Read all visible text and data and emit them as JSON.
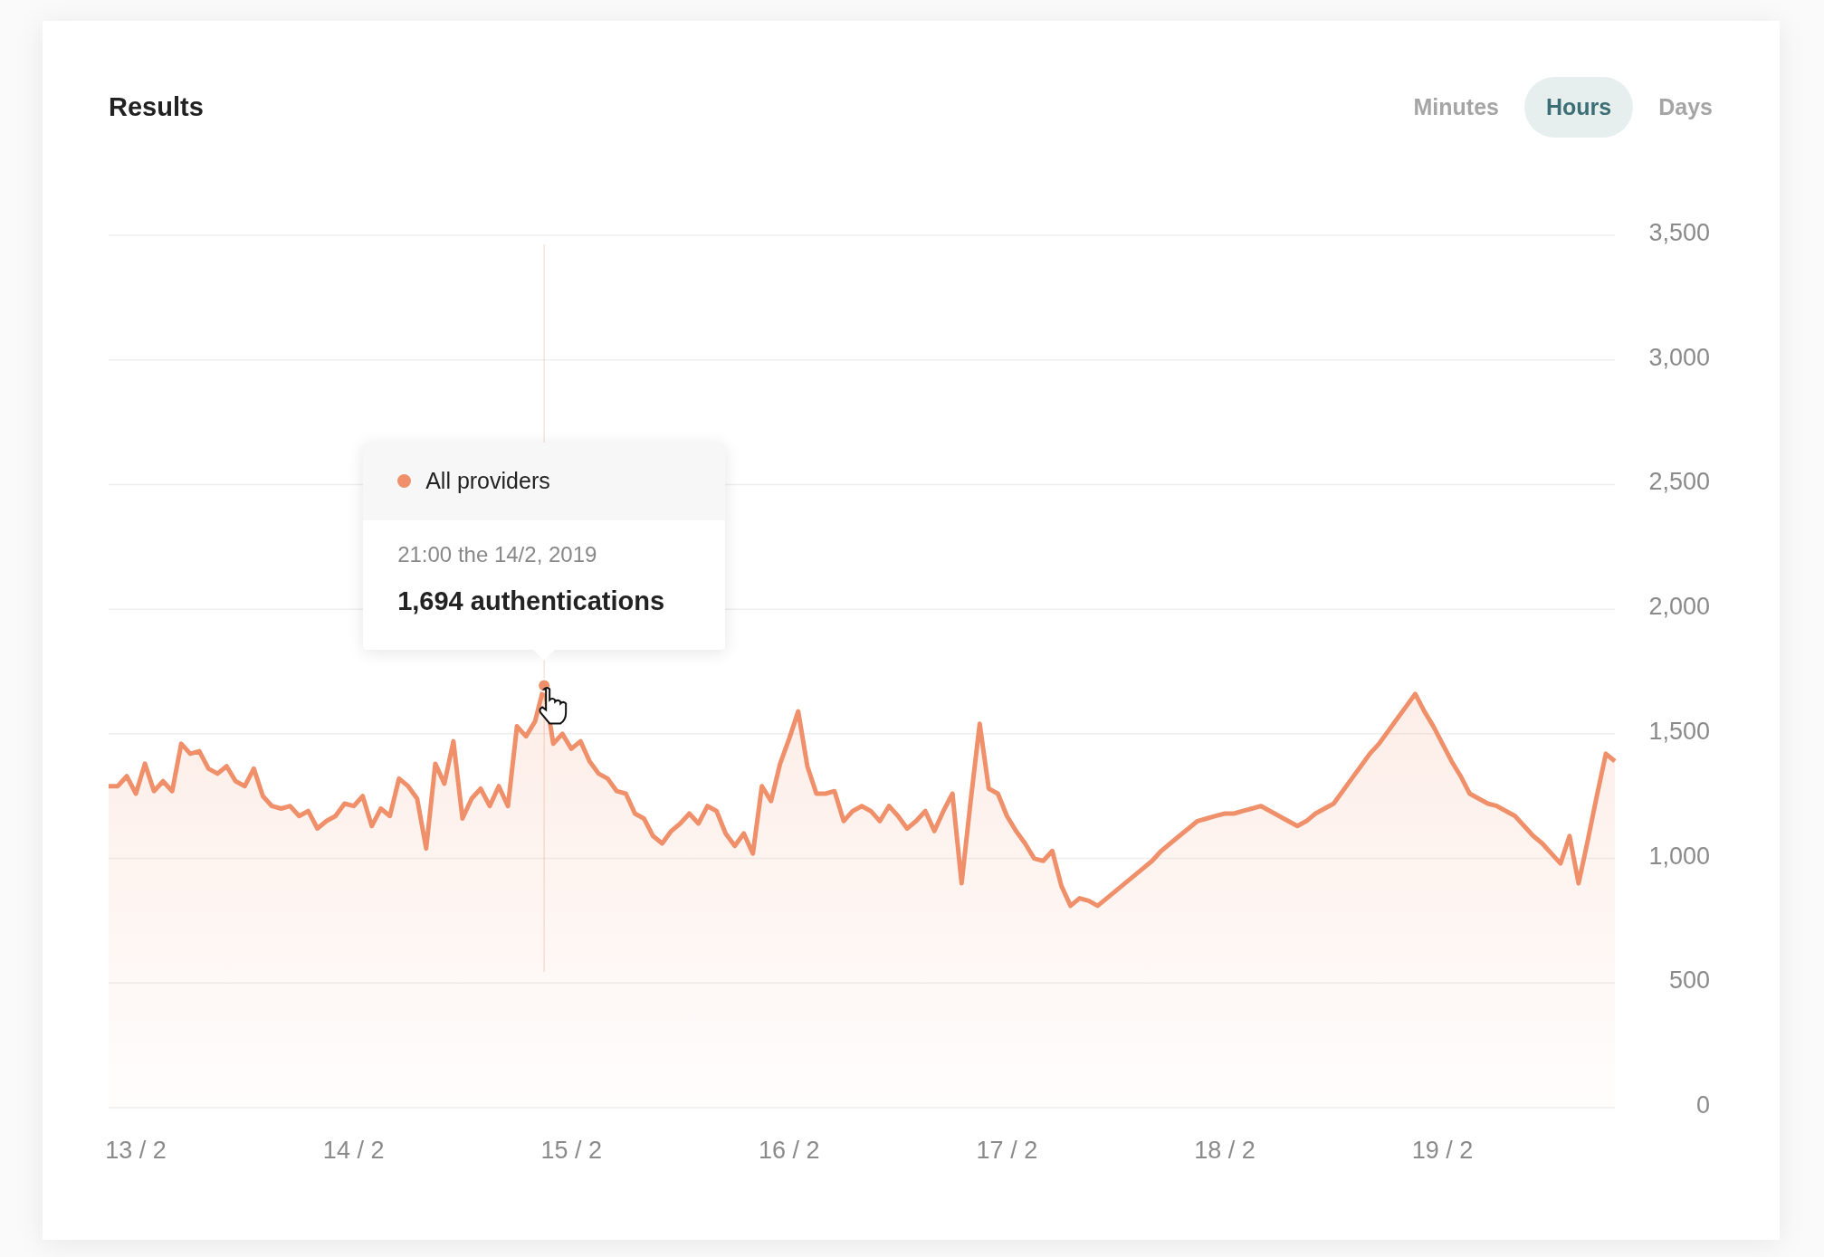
{
  "card": {
    "title": "Results"
  },
  "range_tabs": [
    {
      "label": "Minutes",
      "selected": false
    },
    {
      "label": "Hours",
      "selected": true
    },
    {
      "label": "Days",
      "selected": false
    }
  ],
  "chart": {
    "chart_data": {
      "type": "area",
      "categories": [
        null,
        null,
        null,
        "13 / 2",
        null,
        null,
        null,
        null,
        null,
        null,
        null,
        null,
        null,
        null,
        null,
        null,
        null,
        null,
        null,
        null,
        null,
        null,
        null,
        null,
        null,
        null,
        null,
        "14 / 2",
        null,
        null,
        null,
        null,
        null,
        null,
        null,
        null,
        null,
        null,
        null,
        null,
        null,
        null,
        null,
        null,
        null,
        null,
        null,
        null,
        null,
        null,
        null,
        "15 / 2",
        null,
        null,
        null,
        null,
        null,
        null,
        null,
        null,
        null,
        null,
        null,
        null,
        null,
        null,
        null,
        null,
        null,
        null,
        null,
        null,
        null,
        null,
        null,
        "16 / 2",
        null,
        null,
        null,
        null,
        null,
        null,
        null,
        null,
        null,
        null,
        null,
        null,
        null,
        null,
        null,
        null,
        null,
        null,
        null,
        null,
        null,
        null,
        null,
        "17 / 2",
        null,
        null,
        null,
        null,
        null,
        null,
        null,
        null,
        null,
        null,
        null,
        null,
        null,
        null,
        null,
        null,
        null,
        null,
        null,
        null,
        null,
        null,
        null,
        "18 / 2",
        null,
        null,
        null,
        null,
        null,
        null,
        null,
        null,
        null,
        null,
        null,
        null,
        null,
        null,
        null,
        null,
        null,
        null,
        null,
        null,
        null,
        null,
        null,
        "19 / 2",
        null,
        null,
        null,
        null,
        null,
        null,
        null,
        null,
        null,
        null,
        null,
        null,
        null,
        null,
        null,
        null,
        null,
        null,
        null
      ],
      "grid": true,
      "series": [
        {
          "name": "All providers",
          "color": "#f0906b",
          "values": [
            1290,
            1290,
            1330,
            1260,
            1380,
            1270,
            1310,
            1270,
            1460,
            1420,
            1430,
            1360,
            1340,
            1370,
            1310,
            1290,
            1360,
            1250,
            1210,
            1200,
            1210,
            1170,
            1190,
            1120,
            1150,
            1170,
            1220,
            1210,
            1250,
            1130,
            1200,
            1170,
            1320,
            1290,
            1240,
            1040,
            1380,
            1300,
            1470,
            1160,
            1240,
            1280,
            1210,
            1290,
            1210,
            1530,
            1490,
            1550,
            1694,
            1460,
            1500,
            1440,
            1470,
            1390,
            1340,
            1320,
            1270,
            1260,
            1180,
            1160,
            1090,
            1060,
            1110,
            1140,
            1180,
            1140,
            1210,
            1190,
            1100,
            1050,
            1100,
            1020,
            1290,
            1230,
            1380,
            1480,
            1590,
            1370,
            1260,
            1260,
            1270,
            1150,
            1190,
            1210,
            1190,
            1150,
            1210,
            1170,
            1120,
            1150,
            1190,
            1110,
            1190,
            1260,
            900,
            1230,
            1540,
            1280,
            1260,
            1170,
            1110,
            1060,
            1000,
            990,
            1030,
            890,
            810,
            840,
            830,
            810,
            840,
            870,
            900,
            930,
            960,
            990,
            1030,
            1060,
            1090,
            1120,
            1150,
            1160,
            1170,
            1180,
            1180,
            1190,
            1200,
            1210,
            1190,
            1170,
            1150,
            1130,
            1150,
            1180,
            1200,
            1220,
            1270,
            1320,
            1370,
            1420,
            1460,
            1510,
            1560,
            1610,
            1660,
            1590,
            1530,
            1460,
            1390,
            1330,
            1260,
            1240,
            1220,
            1210,
            1190,
            1170,
            1130,
            1090,
            1060,
            1020,
            980,
            1090,
            900,
            1070,
            1250,
            1420,
            1390
          ]
        }
      ],
      "ylim": [
        0,
        3500
      ],
      "yticks": [
        {
          "value": 0,
          "label": "0"
        },
        {
          "value": 500,
          "label": "500"
        },
        {
          "value": 1000,
          "label": "1,000"
        },
        {
          "value": 1500,
          "label": "1,500"
        },
        {
          "value": 2000,
          "label": "2,000"
        },
        {
          "value": 2500,
          "label": "2,500"
        },
        {
          "value": 3000,
          "label": "3,000"
        },
        {
          "value": 3500,
          "label": "3,500"
        }
      ]
    },
    "tooltip": {
      "time": "21:00 the 14/2, 2019",
      "value": "1,694 authentications"
    }
  }
}
